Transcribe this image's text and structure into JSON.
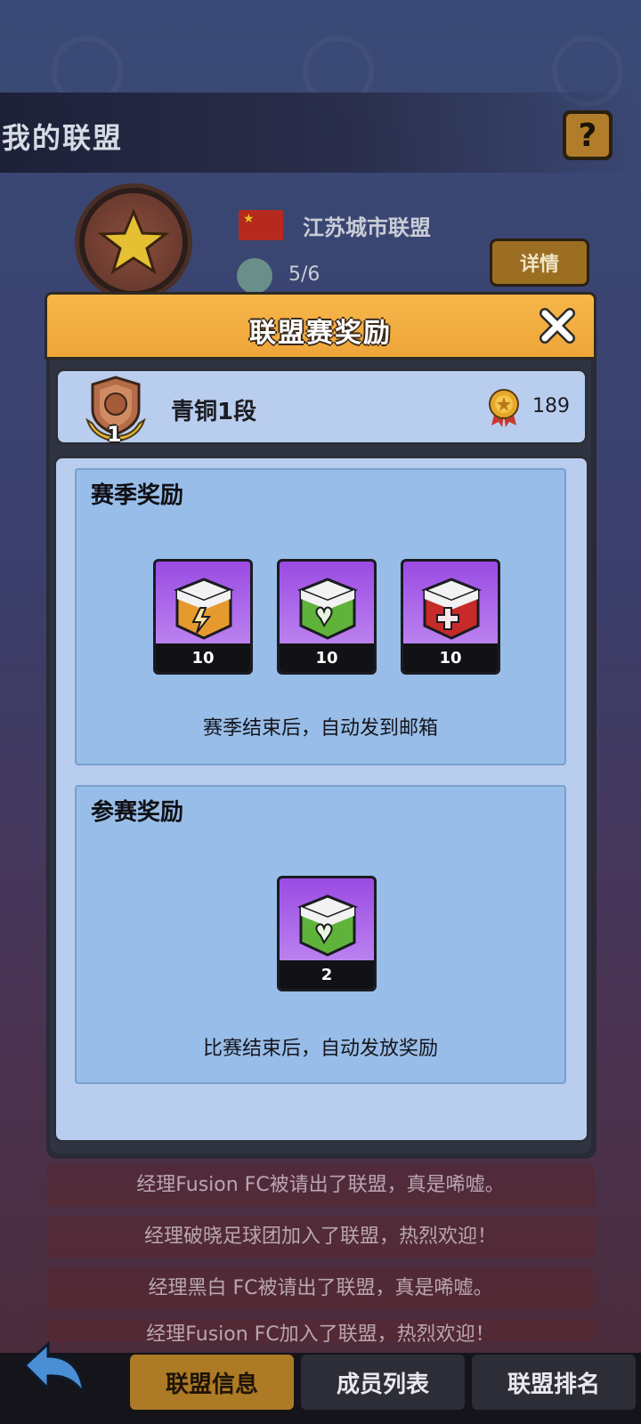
{
  "header": {
    "title": "我的联盟",
    "help_icon": "question-icon"
  },
  "league": {
    "name": "江苏城市联盟",
    "members": "5/6",
    "detail_label": "详情",
    "flag_icon": "china-flag-icon"
  },
  "modal": {
    "title": "联盟赛奖励",
    "rank": {
      "level_number": "1",
      "name": "青铜1段",
      "points": "189"
    },
    "season_rewards": {
      "title": "赛季奖励",
      "items": [
        {
          "icon": "orange-energy-box-icon",
          "count": "10"
        },
        {
          "icon": "green-heart-box-icon",
          "count": "10"
        },
        {
          "icon": "red-plus-box-icon",
          "count": "10"
        }
      ],
      "note": "赛季结束后，自动发到邮箱"
    },
    "participation_rewards": {
      "title": "参赛奖励",
      "items": [
        {
          "icon": "green-heart-box-icon",
          "count": "2"
        }
      ],
      "note": "比赛结束后，自动发放奖励"
    }
  },
  "feed": [
    "经理Fusion FC被请出了联盟，真是唏嘘。",
    "经理破晓足球团加入了联盟，热烈欢迎！",
    "经理黑白 FC被请出了联盟，真是唏嘘。",
    "经理Fusion FC加入了联盟，热烈欢迎！"
  ],
  "nav": {
    "tabs": [
      "联盟信息",
      "成员列表",
      "联盟排名"
    ],
    "active_tab": "联盟信息"
  },
  "colors": {
    "modal_header": "#eea53a",
    "panel": "#b9cdef",
    "section": "#98bde8",
    "active_tab": "#ad7a25",
    "item_bg": "#9a4be3"
  }
}
